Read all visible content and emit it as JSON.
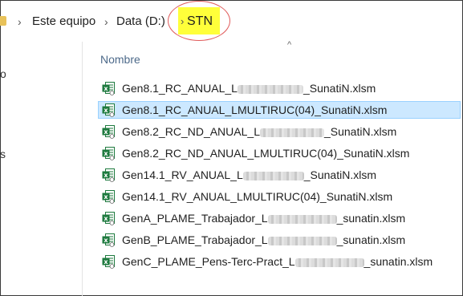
{
  "breadcrumb": {
    "separator": "›",
    "items": [
      "Este equipo",
      "Data (D:)"
    ],
    "current": "STN",
    "highlight_color": "#ffff3a",
    "ring_color": "#e05a5a"
  },
  "nav_pane": {
    "visible_chars": [
      "o",
      "s"
    ]
  },
  "column": {
    "name_header": "Nombre",
    "sort_indicator": "^"
  },
  "files": [
    {
      "prefix": "Gen8.1_RC_ANUAL_L",
      "redacted": true,
      "suffix": "_SunatiN.xlsm",
      "selected": false
    },
    {
      "prefix": "Gen8.1_RC_ANUAL_LMULTIRUC(04)_SunatiN.xlsm",
      "redacted": false,
      "suffix": "",
      "selected": true
    },
    {
      "prefix": "Gen8.2_RC_ND_ANUAL_L",
      "redacted": true,
      "suffix": "_SunatiN.xlsm",
      "selected": false
    },
    {
      "prefix": "Gen8.2_RC_ND_ANUAL_LMULTIRUC(04)_SunatiN.xlsm",
      "redacted": false,
      "suffix": "",
      "selected": false
    },
    {
      "prefix": "Gen14.1_RV_ANUAL_L",
      "redacted": true,
      "suffix": "_SunatiN.xlsm",
      "selected": false
    },
    {
      "prefix": "Gen14.1_RV_ANUAL_LMULTIRUC(04)_SunatiN.xlsm",
      "redacted": false,
      "suffix": "",
      "selected": false
    },
    {
      "prefix": "GenA_PLAME_Trabajador_L",
      "redacted": true,
      "suffix": "_sunatin.xlsm",
      "selected": false
    },
    {
      "prefix": "GenB_PLAME_Trabajador_L",
      "redacted": true,
      "suffix": "_sunatin.xlsm",
      "selected": false
    },
    {
      "prefix": "GenC_PLAME_Pens-Terc-Pract_L",
      "redacted": true,
      "suffix": "_sunatin.xlsm",
      "selected": false
    }
  ],
  "icons": {
    "file_icon": "excel-macro-icon",
    "excel_green": "#1d7a3e"
  }
}
